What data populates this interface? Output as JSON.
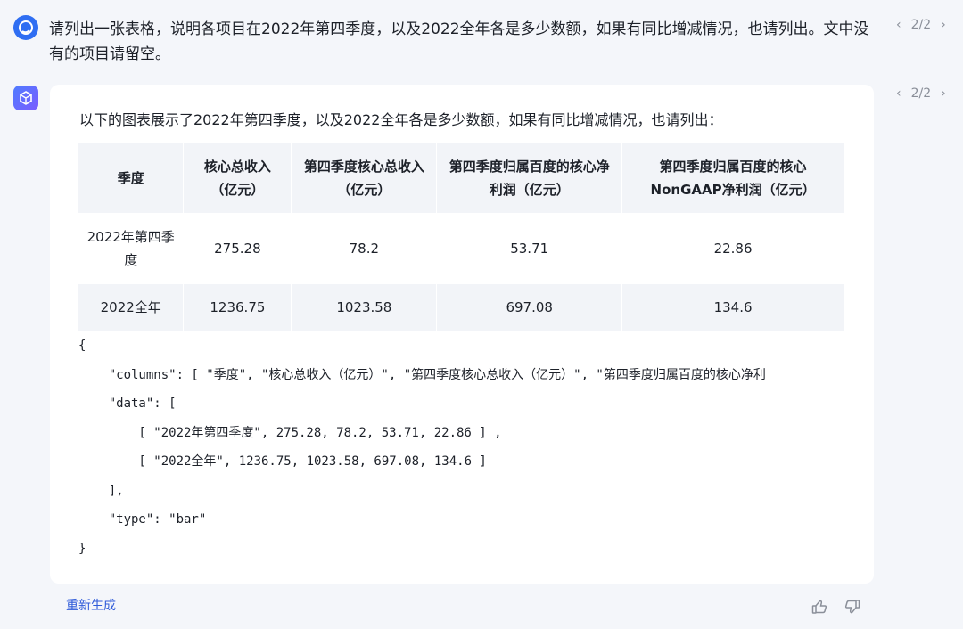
{
  "user_message": {
    "text": "请列出一张表格，说明各项目在2022年第四季度，以及2022全年各是多少数额，如果有同比增减情况，也请列出。文中没有的项目请留空。",
    "pager": "2/2"
  },
  "ai_message": {
    "pager": "2/2",
    "intro": "以下的图表展示了2022年第四季度，以及2022全年各是多少数额，如果有同比增减情况，也请列出：",
    "table": {
      "headers": [
        "季度",
        "核心总收入（亿元）",
        "第四季度核心总收入（亿元）",
        "第四季度归属百度的核心净利润（亿元）",
        "第四季度归属百度的核心NonGAAP净利润（亿元）"
      ],
      "rows": [
        [
          "2022年第四季度",
          "275.28",
          "78.2",
          "53.71",
          "22.86"
        ],
        [
          "2022全年",
          "1236.75",
          "1023.58",
          "697.08",
          "134.6"
        ]
      ]
    },
    "code_lines": [
      "{",
      "    \"columns\": [ \"季度\", \"核心总收入（亿元）\", \"第四季度核心总收入（亿元）\", \"第四季度归属百度的核心净利",
      "    \"data\": [",
      "        [ \"2022年第四季度\", 275.28, 78.2, 53.71, 22.86 ] ,",
      "        [ \"2022全年\", 1236.75, 1023.58, 697.08, 134.6 ]",
      "    ],",
      "    \"type\": \"bar\"",
      "}"
    ]
  },
  "actions": {
    "regenerate_label": "重新生成"
  },
  "icons": {
    "user_avatar": "user-avatar-icon",
    "ai_avatar": "cube-logo-icon",
    "prev": "chevron-left-icon",
    "next": "chevron-right-icon",
    "thumbs_up": "thumbs-up-icon",
    "thumbs_down": "thumbs-down-icon"
  },
  "colors": {
    "accent": "#2f5bd9",
    "table_header_bg": "#f2f4f8",
    "page_bg": "#f4f6fa"
  }
}
